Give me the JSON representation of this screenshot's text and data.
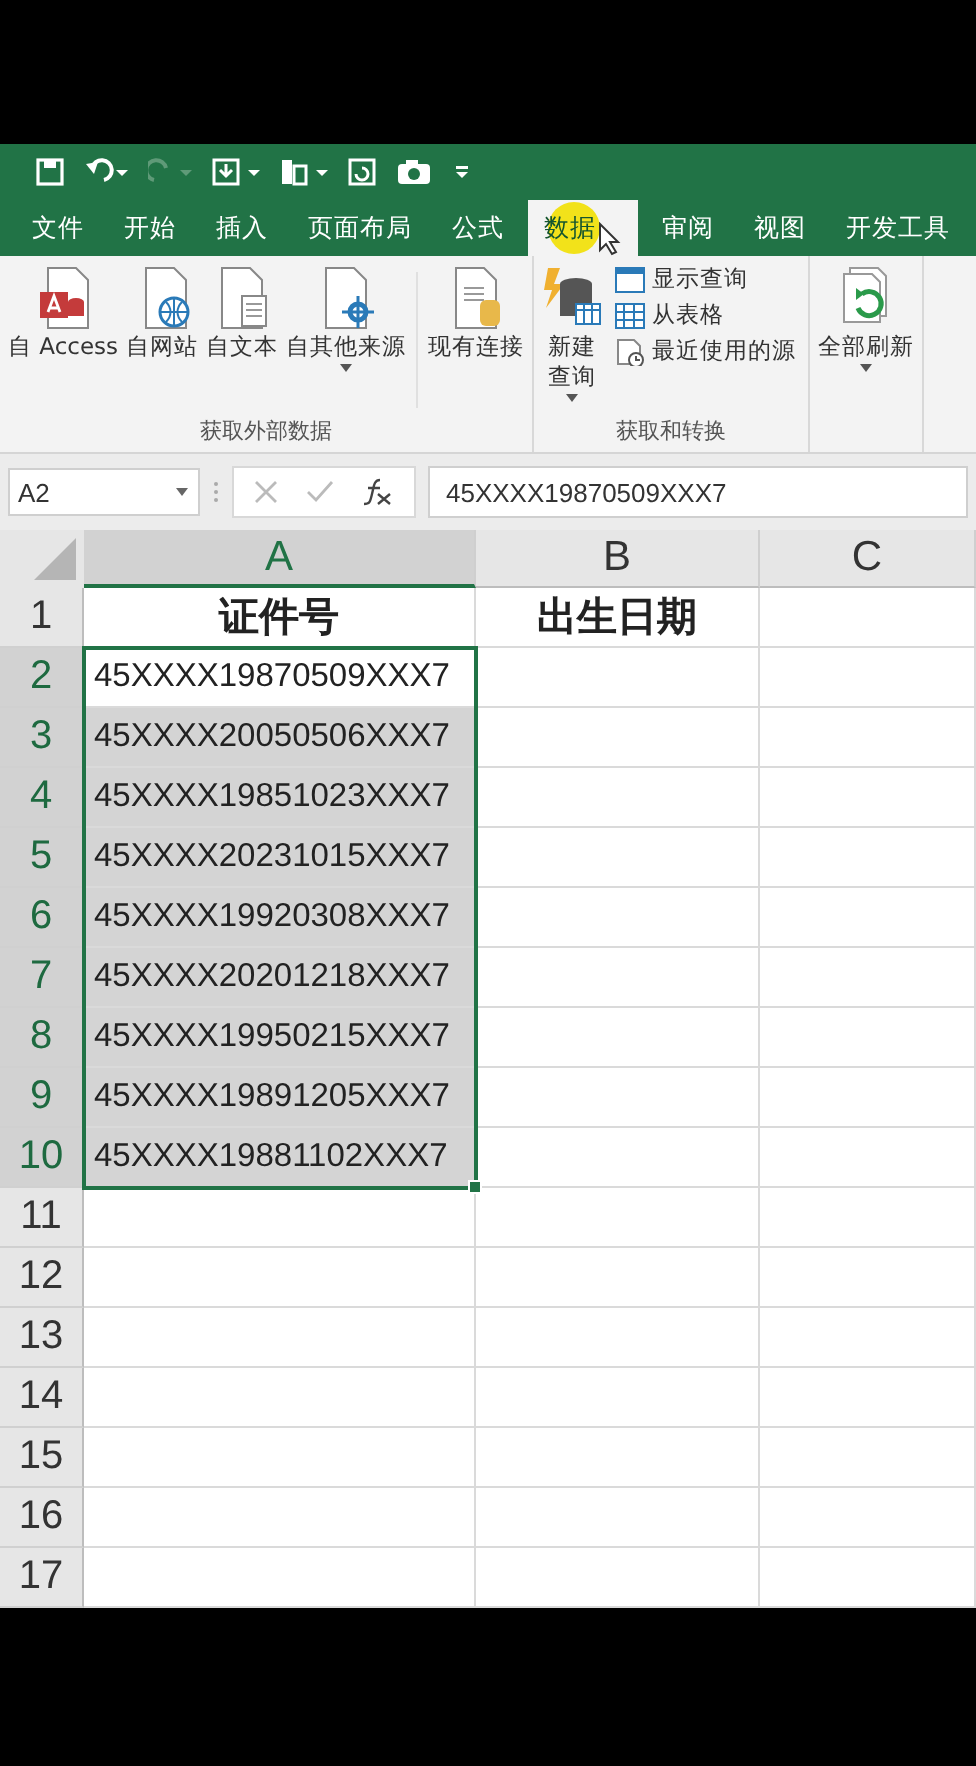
{
  "tabs": [
    {
      "label": "文件",
      "selected": false
    },
    {
      "label": "开始",
      "selected": false
    },
    {
      "label": "插入",
      "selected": false
    },
    {
      "label": "页面布局",
      "selected": false
    },
    {
      "label": "公式",
      "selected": false
    },
    {
      "label": "数据",
      "selected": true
    },
    {
      "label": "审阅",
      "selected": false
    },
    {
      "label": "视图",
      "selected": false
    },
    {
      "label": "开发工具",
      "selected": false
    }
  ],
  "ribbon": {
    "groups": [
      {
        "label": "获取外部数据",
        "buttons": [
          {
            "kind": "access",
            "label": "自 Access"
          },
          {
            "kind": "web",
            "label": "自网站"
          },
          {
            "kind": "text",
            "label": "自文本"
          },
          {
            "kind": "other",
            "label": "自其他来源",
            "dropdown": true
          },
          {
            "kind": "connection",
            "label": "现有连接"
          }
        ]
      },
      {
        "label": "获取和转换",
        "buttons": [
          {
            "kind": "query",
            "label": "新建查询",
            "dropdown": true
          },
          {
            "kind": "show",
            "label": "显示查询"
          },
          {
            "kind": "table",
            "label": "从表格"
          },
          {
            "kind": "recent",
            "label": "最近使用的源"
          }
        ]
      },
      {
        "buttons": [
          {
            "kind": "refresh",
            "label": "全部刷新",
            "dropdown": true
          }
        ]
      }
    ]
  },
  "formula_bar": {
    "name_box": "A2",
    "formula": "45XXXX19870509XXX7"
  },
  "sheet": {
    "columns": [
      {
        "label": "A",
        "selected": true
      },
      {
        "label": "B",
        "selected": false
      },
      {
        "label": "C",
        "selected": false
      }
    ],
    "rows": [
      {
        "number": "1",
        "selected": false,
        "cells": [
          "证件号",
          "出生日期"
        ]
      },
      {
        "number": "2",
        "selected": true,
        "active": true,
        "cells": [
          "45XXXX19870509XXX7"
        ]
      },
      {
        "number": "3",
        "selected": true,
        "active": false,
        "cells": [
          "45XXXX20050506XXX7"
        ]
      },
      {
        "number": "4",
        "selected": true,
        "active": false,
        "cells": [
          "45XXXX19851023XXX7"
        ]
      },
      {
        "number": "5",
        "selected": true,
        "active": false,
        "cells": [
          "45XXXX20231015XXX7"
        ]
      },
      {
        "number": "6",
        "selected": true,
        "active": false,
        "cells": [
          "45XXXX19920308XXX7"
        ]
      },
      {
        "number": "7",
        "selected": true,
        "active": false,
        "cells": [
          "45XXXX20201218XXX7"
        ]
      },
      {
        "number": "8",
        "selected": true,
        "active": false,
        "cells": [
          "45XXXX19950215XXX7"
        ]
      },
      {
        "number": "9",
        "selected": true,
        "active": false,
        "cells": [
          "45XXXX19891205XXX7"
        ]
      },
      {
        "number": "10",
        "selected": true,
        "active": false,
        "cells": [
          "45XXXX19881102XXX7"
        ]
      },
      {
        "number": "11",
        "selected": false
      },
      {
        "number": "12",
        "selected": false
      },
      {
        "number": "13",
        "selected": false
      },
      {
        "number": "14",
        "selected": false
      },
      {
        "number": "15",
        "selected": false
      },
      {
        "number": "16",
        "selected": false
      },
      {
        "number": "17",
        "selected": false
      }
    ]
  }
}
